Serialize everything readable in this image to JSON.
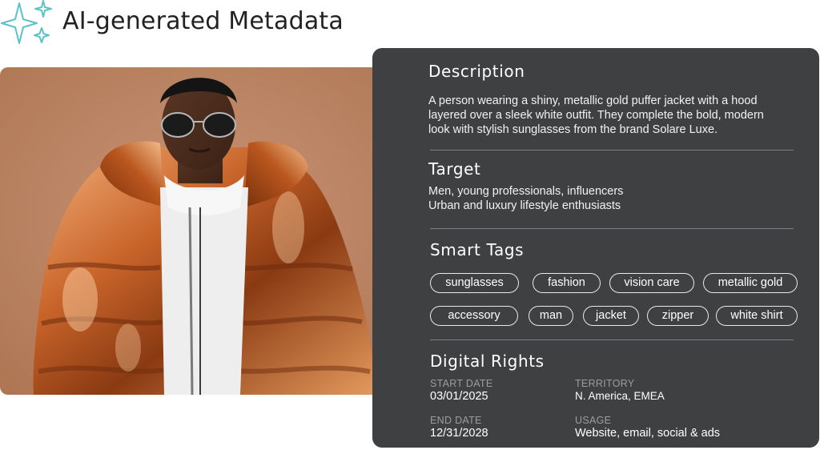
{
  "header": {
    "title": "AI-generated Metadata",
    "logo_icon": "sparkles-icon",
    "accent_color": "#5bc3c6"
  },
  "photo": {
    "alt": "Person in metallic gold puffer jacket",
    "background_color": "#b67b57"
  },
  "panel": {
    "background_color": "#3f4042",
    "description": {
      "title": "Description",
      "lines": [
        "A person wearing a shiny, metallic gold puffer jacket with a hood",
        "layered over a sleek white outfit. They complete the bold, modern",
        "look with stylish sunglasses from the brand Solare Luxe."
      ]
    },
    "target": {
      "title": "Target",
      "lines": [
        "Men, young professionals, influencers",
        "Urban and luxury lifestyle enthusiasts"
      ]
    },
    "smart_tags": {
      "title": "Smart Tags",
      "tags": [
        "sunglasses",
        "fashion",
        "vision care",
        "metallic gold",
        "accessory",
        "man",
        "jacket",
        "zipper",
        "white shirt"
      ]
    },
    "digital_rights": {
      "title": "Digital Rights",
      "start_date_label": "START DATE",
      "start_date": "03/01/2025",
      "territory_label": "TERRITORY",
      "territory": "N. America, EMEA",
      "end_date_label": "END DATE",
      "end_date": "12/31/2028",
      "usage_label": "USAGE",
      "usage": "Website, email, social & ads"
    }
  }
}
